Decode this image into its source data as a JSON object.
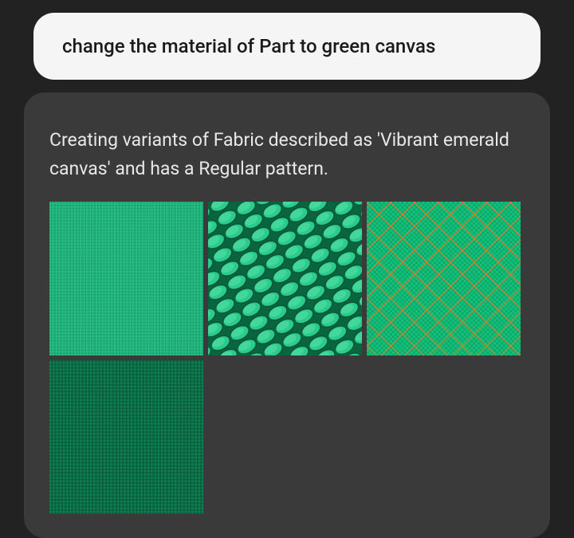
{
  "user_message": "change the material of Part to green canvas",
  "response_text": "Creating variants of Fabric described as 'Vibrant emerald canvas' and has a Regular pattern.",
  "swatches": [
    {
      "name": "swatch-canvas-fine",
      "alt": "Fine emerald canvas weave"
    },
    {
      "name": "swatch-canvas-knit",
      "alt": "Emerald braided knit texture"
    },
    {
      "name": "swatch-canvas-mesh",
      "alt": "Emerald diamond mesh with orange lines"
    },
    {
      "name": "swatch-canvas-dense",
      "alt": "Dense dark emerald woven canvas"
    }
  ]
}
